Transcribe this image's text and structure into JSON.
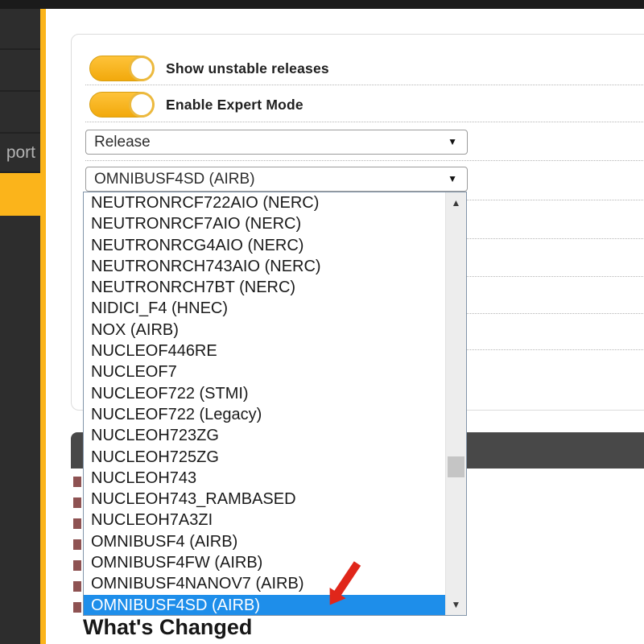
{
  "sidebar": {
    "partial_item_label": "port"
  },
  "settings": {
    "toggles": [
      {
        "label": "Show unstable releases",
        "on": true
      },
      {
        "label": "Enable Expert Mode",
        "on": true
      }
    ],
    "release_select": {
      "value": "Release"
    },
    "target_select": {
      "value": "OMNIBUSF4SD (AIRB)"
    }
  },
  "target_dropdown": {
    "options": [
      "NEUTRONRCF722AIO (NERC)",
      "NEUTRONRCF7AIO (NERC)",
      "NEUTRONRCG4AIO (NERC)",
      "NEUTRONRCH743AIO (NERC)",
      "NEUTRONRCH7BT (NERC)",
      "NIDICI_F4 (HNEC)",
      "NOX (AIRB)",
      "NUCLEOF446RE",
      "NUCLEOF7",
      "NUCLEOF722 (STMI)",
      "NUCLEOF722 (Legacy)",
      "NUCLEOH723ZG",
      "NUCLEOH725ZG",
      "NUCLEOH743",
      "NUCLEOH743_RAMBASED",
      "NUCLEOH7A3ZI",
      "OMNIBUSF4 (AIRB)",
      "OMNIBUSF4FW (AIRB)",
      "OMNIBUSF4NANOV7 (AIRB)",
      "OMNIBUSF4SD (AIRB)"
    ],
    "selected_option": "OMNIBUSF4SD (AIRB)",
    "selected_index": 19
  },
  "release_notes": {
    "heading": "What's Changed"
  },
  "icons": {
    "chevron_down": "▼",
    "scroll_up": "▲",
    "scroll_down": "▼"
  },
  "colors": {
    "accent_yellow": "#fbb41b",
    "selection_blue": "#1e8eea",
    "header_band": "#484848",
    "annotation_red": "#e0261a"
  }
}
